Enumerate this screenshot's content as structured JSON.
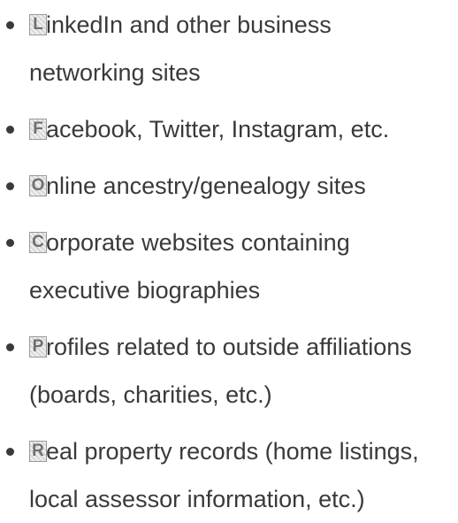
{
  "bullets": [
    {
      "first_letter": "L",
      "lines": [
        "inkedIn and other business",
        "networking sites"
      ]
    },
    {
      "first_letter": "F",
      "lines": [
        "acebook, Twitter, Instagram, etc."
      ]
    },
    {
      "first_letter": "O",
      "lines": [
        "nline ancestry/genealogy sites"
      ]
    },
    {
      "first_letter": "C",
      "lines": [
        "orporate websites containing",
        "executive biographies"
      ]
    },
    {
      "first_letter": "P",
      "lines": [
        "rofiles related to outside affiliations",
        "(boards, charities, etc.)"
      ]
    },
    {
      "first_letter": "R",
      "lines": [
        "eal property records (home listings,",
        "local assessor information, etc.)"
      ]
    }
  ],
  "colors": {
    "text": "#3a3a3a",
    "glyph_border": "#9a9a9a"
  },
  "icons": {
    "bullet": "bullet-dot-icon",
    "glyph": "image-glyph-icon"
  }
}
